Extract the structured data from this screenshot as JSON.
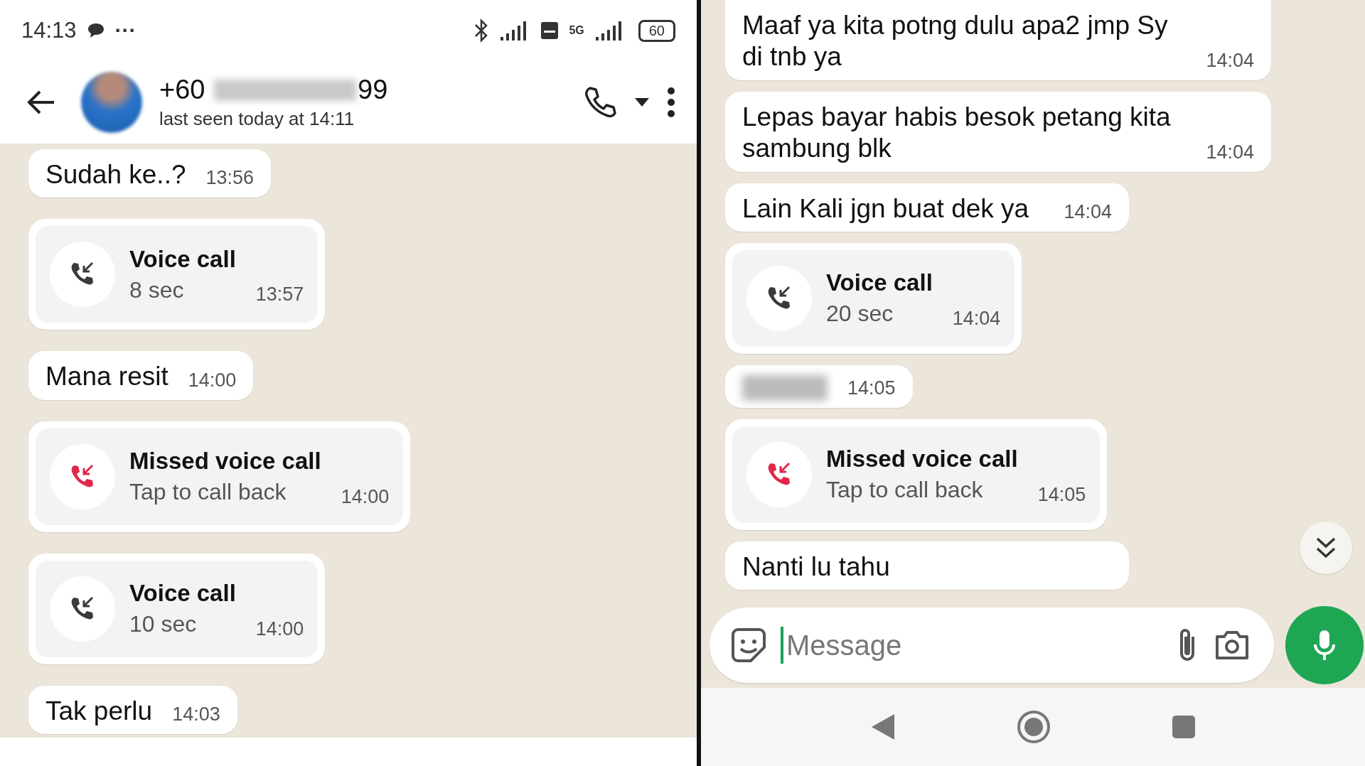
{
  "left_screen": {
    "status_bar": {
      "time": "14:13",
      "more": "···",
      "network": "5G",
      "battery": "60"
    },
    "header": {
      "number_start": "+60 ",
      "number_end": "99",
      "status": "last seen today at 14:11"
    },
    "messages": [
      {
        "kind": "text",
        "text": "Sudah ke..?",
        "time": "13:56"
      },
      {
        "kind": "call",
        "title": "Voice call",
        "subtitle": "8 sec",
        "time": "13:57",
        "missed": false
      },
      {
        "kind": "text",
        "text": "Mana resit",
        "time": "14:00"
      },
      {
        "kind": "call",
        "title": "Missed voice call",
        "subtitle": "Tap to call back",
        "time": "14:00",
        "missed": true
      },
      {
        "kind": "call",
        "title": "Voice call",
        "subtitle": "10 sec",
        "time": "14:00",
        "missed": false
      },
      {
        "kind": "text",
        "text": "Tak perlu",
        "time": "14:03"
      }
    ]
  },
  "right_screen": {
    "messages": [
      {
        "kind": "text",
        "text": "Maaf ya kita potng dulu apa2 jmp Sy di tnb ya",
        "time": "14:04"
      },
      {
        "kind": "text",
        "text": "Lepas bayar habis besok petang kita sambung blk",
        "time": "14:04"
      },
      {
        "kind": "text",
        "text": "Lain Kali jgn buat dek ya",
        "time": "14:04"
      },
      {
        "kind": "call",
        "title": "Voice call",
        "subtitle": "20 sec",
        "time": "14:04",
        "missed": false
      },
      {
        "kind": "blurred",
        "time": "14:05"
      },
      {
        "kind": "call",
        "title": "Missed voice call",
        "subtitle": "Tap to call back",
        "time": "14:05",
        "missed": true
      },
      {
        "kind": "text",
        "text": "Nanti lu tahu"
      }
    ],
    "composer": {
      "placeholder": "Message"
    }
  }
}
